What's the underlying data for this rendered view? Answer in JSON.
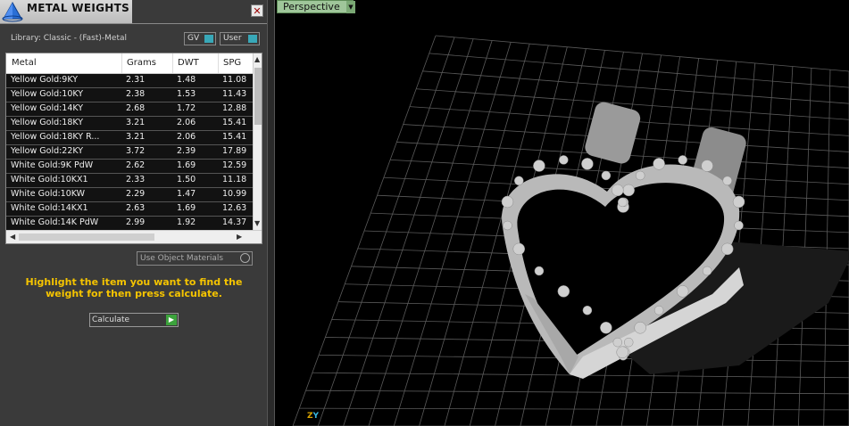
{
  "panel": {
    "title": "METAL WEIGHTS",
    "close_glyph": "✕",
    "library_label": "Library: Classic - (Fast)-Metal",
    "toggles": [
      {
        "label": "GV"
      },
      {
        "label": "User"
      }
    ],
    "table": {
      "columns": [
        "Metal",
        "Grams",
        "DWT",
        "SPG"
      ],
      "rows": [
        {
          "metal": "Yellow Gold:9KY",
          "grams": "2.31",
          "dwt": "1.48",
          "spg": "11.08"
        },
        {
          "metal": "Yellow Gold:10KY",
          "grams": "2.38",
          "dwt": "1.53",
          "spg": "11.43"
        },
        {
          "metal": "Yellow Gold:14KY",
          "grams": "2.68",
          "dwt": "1.72",
          "spg": "12.88"
        },
        {
          "metal": "Yellow Gold:18KY",
          "grams": "3.21",
          "dwt": "2.06",
          "spg": "15.41"
        },
        {
          "metal": "Yellow Gold:18KY R...",
          "grams": "3.21",
          "dwt": "2.06",
          "spg": "15.41"
        },
        {
          "metal": "Yellow Gold:22KY",
          "grams": "3.72",
          "dwt": "2.39",
          "spg": "17.89"
        },
        {
          "metal": "White Gold:9K PdW",
          "grams": "2.62",
          "dwt": "1.69",
          "spg": "12.59"
        },
        {
          "metal": "White Gold:10KX1",
          "grams": "2.33",
          "dwt": "1.50",
          "spg": "11.18"
        },
        {
          "metal": "White Gold:10KW",
          "grams": "2.29",
          "dwt": "1.47",
          "spg": "10.99"
        },
        {
          "metal": "White Gold:14KX1",
          "grams": "2.63",
          "dwt": "1.69",
          "spg": "12.63"
        },
        {
          "metal": "White Gold:14K PdW",
          "grams": "2.99",
          "dwt": "1.92",
          "spg": "14.37"
        }
      ]
    },
    "use_object_materials_label": "Use Object Materials",
    "instruction": "Highlight the item you want to find the weight for then press calculate.",
    "calculate_label": "Calculate"
  },
  "viewport": {
    "view_name": "Perspective",
    "axis_z": "Z",
    "axis_y": "Y"
  },
  "colors": {
    "panel_bg": "#3a3a3a",
    "instruction_text": "#f5c400",
    "toggle_accent": "#38a8b8",
    "calc_accent": "#3ca33c",
    "view_tab": "#9fc69a",
    "axis_z": "#d9a400",
    "axis_y": "#38b8e0"
  },
  "icons": {
    "logo": "pyramid-logo-icon",
    "close": "close-icon",
    "calculate": "play-arrow-icon",
    "view_dropdown": "chevron-down-icon"
  }
}
